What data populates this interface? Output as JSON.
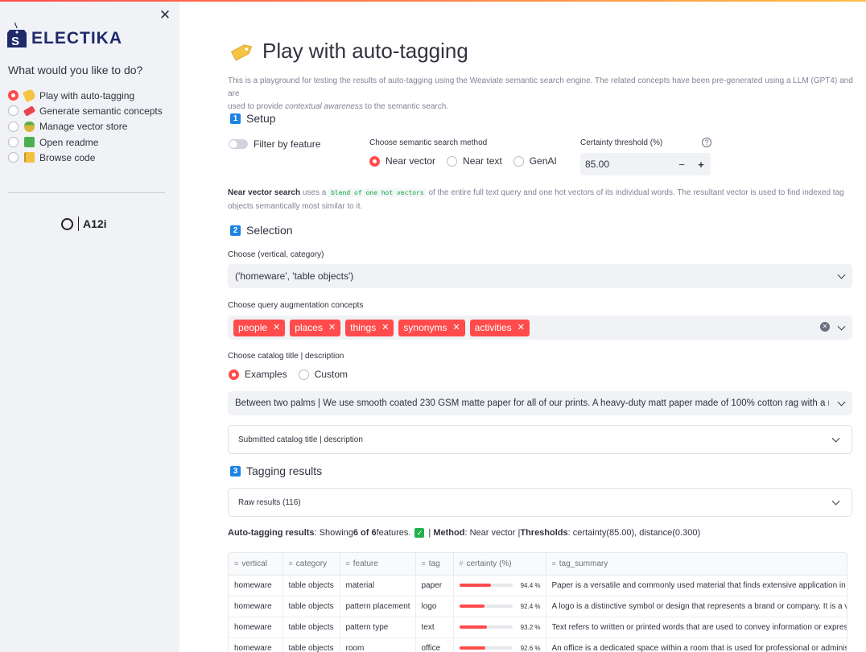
{
  "sidebar": {
    "brand": "ELECTIKA",
    "question": "What would you like to do?",
    "items": [
      {
        "label": "Play with auto-tagging",
        "icon": "tag-icon",
        "selected": true,
        "color": "#f5c443"
      },
      {
        "label": "Generate semantic concepts",
        "icon": "ticket-icon",
        "selected": false,
        "color": "#e8444f"
      },
      {
        "label": "Manage vector store",
        "icon": "pineapple-icon",
        "selected": false,
        "color": "#d9b43a"
      },
      {
        "label": "Open readme",
        "icon": "green-book-icon",
        "selected": false,
        "color": "#4caf50"
      },
      {
        "label": "Browse code",
        "icon": "notebook-icon",
        "selected": false,
        "color": "#f2c13f"
      }
    ],
    "footer_logo": "A12i"
  },
  "main": {
    "title": "Play with auto-tagging",
    "intro_1": "This is a playground for testing the results of auto-tagging using the Weaviate semantic search engine. The related concepts have been pre-generated using a LLM (GPT4) and are",
    "intro_2a": "used to provide ",
    "intro_2b": "contextual awareness",
    "intro_2c": " to the semantic search.",
    "setup": {
      "num": "1",
      "title": "Setup",
      "toggle_label": "Filter by feature",
      "method_label": "Choose semantic search method",
      "methods": [
        "Near vector",
        "Near text",
        "GenAI"
      ],
      "threshold_label": "Certainty threshold (%)",
      "threshold_value": "85.00",
      "minus": "−",
      "plus": "+",
      "desc_bold": "Near vector search",
      "desc_1": " uses a ",
      "desc_code": "blend of one hot vectors",
      "desc_2": " of the entire full text query and one hot vectors of its individual words. The resultant vector is used to find indexed tag",
      "desc_3": "objects semantically most similar to it."
    },
    "selection": {
      "num": "2",
      "title": "Selection",
      "vc_label": "Choose (vertical, category)",
      "vc_value": "('homeware', 'table objects')",
      "concepts_label": "Choose query augmentation concepts",
      "concepts": [
        "people",
        "places",
        "things",
        "synonyms",
        "activities"
      ],
      "catalog_label": "Choose catalog title | description",
      "catalog_options": [
        "Examples",
        "Custom"
      ],
      "catalog_value": "Between two palms | We use smooth coated 230 GSM matte paper for all of our prints. A heavy-duty matt paper made of 100% cotton rag with a n...",
      "submitted_label": "Submitted catalog title | description"
    },
    "results": {
      "num": "3",
      "title": "Tagging results",
      "raw_label": "Raw results (116)",
      "summary_label": "Auto-tagging results",
      "summary_showing": ": Showing ",
      "summary_count": "6 of 6",
      "summary_features": " features.",
      "method_label": "Method",
      "method_value": ": Near vector | ",
      "thresholds_label": "Thresholds",
      "thresholds_value": ": certainty(85.00), distance(0.300)",
      "columns": [
        "vertical",
        "category",
        "feature",
        "tag",
        "certainty (%)",
        "tag_summary"
      ],
      "rows": [
        {
          "vertical": "homeware",
          "category": "table objects",
          "feature": "material",
          "tag": "paper",
          "certainty": "94.4 %",
          "fill": 0.6,
          "summary": "Paper is a versatile and commonly used material that finds extensive application in va"
        },
        {
          "vertical": "homeware",
          "category": "table objects",
          "feature": "pattern placement",
          "tag": "logo",
          "certainty": "92.4 %",
          "fill": 0.48,
          "summary": "A logo is a distinctive symbol or design that represents a brand or company. It is a visu"
        },
        {
          "vertical": "homeware",
          "category": "table objects",
          "feature": "pattern type",
          "tag": "text",
          "certainty": "93.2 %",
          "fill": 0.52,
          "summary": "Text refers to written or printed words that are used to convey information or express"
        },
        {
          "vertical": "homeware",
          "category": "table objects",
          "feature": "room",
          "tag": "office",
          "certainty": "92.6 %",
          "fill": 0.49,
          "summary": "An office is a dedicated space within a room that is used for professional or administr"
        }
      ]
    }
  }
}
